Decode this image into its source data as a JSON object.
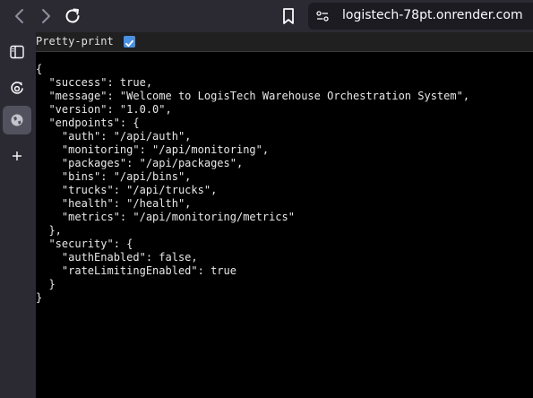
{
  "browser": {
    "url": "logistech-78pt.onrender.com",
    "icons": [
      "back-icon",
      "forward-icon",
      "reload-icon",
      "bookmark-icon",
      "site-info-icon"
    ]
  },
  "sidebar": {
    "items": [
      {
        "name": "sidebar-toggle-icon"
      },
      {
        "name": "assistant-icon"
      },
      {
        "name": "globe-icon"
      },
      {
        "name": "add-icon"
      }
    ]
  },
  "viewer": {
    "pretty_print_label": "Pretty-print",
    "pretty_print_checked": true
  },
  "json_lines": [
    "{",
    "  \"success\": true,",
    "  \"message\": \"Welcome to LogisTech Warehouse Orchestration System\",",
    "  \"version\": \"1.0.0\",",
    "  \"endpoints\": {",
    "    \"auth\": \"/api/auth\",",
    "    \"monitoring\": \"/api/monitoring\",",
    "    \"packages\": \"/api/packages\",",
    "    \"bins\": \"/api/bins\",",
    "    \"trucks\": \"/api/trucks\",",
    "    \"health\": \"/health\",",
    "    \"metrics\": \"/api/monitoring/metrics\"",
    "  },",
    "  \"security\": {",
    "    \"authEnabled\": false,",
    "    \"rateLimitingEnabled\": true",
    "  }",
    "}"
  ]
}
